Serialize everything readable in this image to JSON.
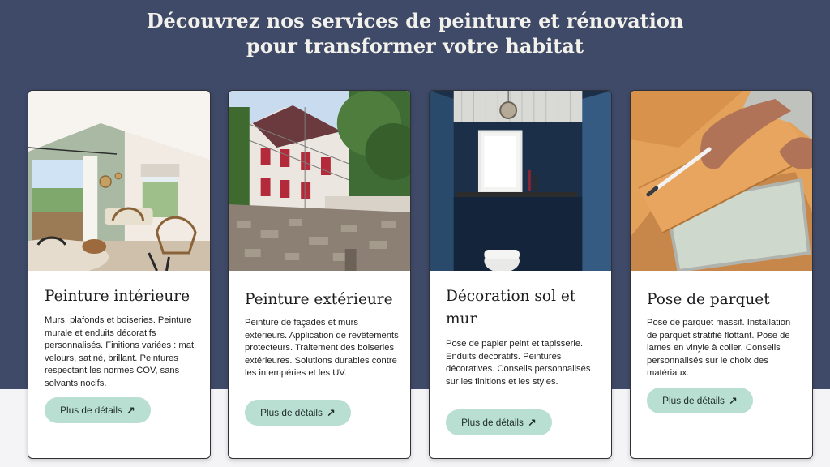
{
  "hero": {
    "title_line1": "Découvrez nos services de peinture et rénovation",
    "title_line2": "pour transformer votre habitat"
  },
  "cards": [
    {
      "title": "Peinture intérieure",
      "description": "Murs, plafonds et boiseries. Peinture murale et enduits décoratifs personnalisés. Finitions variées : mat, velours, satiné, brillant. Peintures respectant les normes COV, sans solvants nocifs.",
      "button_label": "Plus de détails",
      "image_icon": "interior-living-room-photo"
    },
    {
      "title": "Peinture extérieure",
      "description": "Peinture de façades et murs extérieurs. Application de revêtements protecteurs. Traitement des boiseries extérieures. Solutions durables contre les intempéries et les UV.",
      "button_label": "Plus de détails",
      "image_icon": "house-facade-photo"
    },
    {
      "title": "Décoration sol et mur",
      "description": "Pose de papier peint et tapisserie. Enduits décoratifs. Peintures décoratives. Conseils personnalisés sur les finitions et les styles.",
      "button_label": "Plus de détails",
      "image_icon": "bathroom-wall-photo"
    },
    {
      "title": "Pose de parquet",
      "description": "Pose de parquet massif. Installation de parquet stratifié flottant. Pose de lames en vinyle à coller. Conseils personnalisés sur le choix des matériaux.",
      "button_label": "Plus de détails",
      "image_icon": "parquet-installation-photo"
    }
  ],
  "arrow_glyph": "↗",
  "colors": {
    "hero_background": "#3f4a68",
    "button_background": "#b9dfd3",
    "card_border": "#2f3138"
  }
}
